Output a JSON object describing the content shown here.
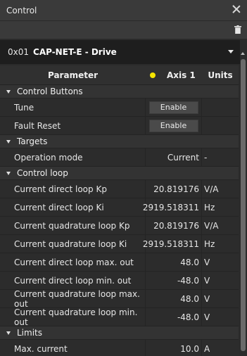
{
  "window": {
    "title": "Control",
    "close_icon": "close-icon",
    "trash_icon": "trash-icon"
  },
  "device": {
    "address": "0x01",
    "name": "CAP-NET-E - Drive"
  },
  "table": {
    "headers": {
      "parameter": "Parameter",
      "axis": "Axis 1",
      "units": "Units",
      "axis_dot_color": "#f5e400"
    },
    "groups": [
      {
        "label": "Control Buttons",
        "rows": [
          {
            "param": "Tune",
            "button": "Enable"
          },
          {
            "param": "Fault Reset",
            "button": "Enable"
          }
        ]
      },
      {
        "label": "Targets",
        "rows": [
          {
            "param": "Operation mode",
            "value": "Current",
            "unit": "-"
          }
        ]
      },
      {
        "label": "Control loop",
        "rows": [
          {
            "param": "Current direct loop Kp",
            "value": "20.819176",
            "unit": "V/A"
          },
          {
            "param": "Current direct loop Ki",
            "value": "2919.518311",
            "unit": "Hz"
          },
          {
            "param": "Current quadrature loop Kp",
            "value": "20.819176",
            "unit": "V/A"
          },
          {
            "param": "Current quadrature loop Ki",
            "value": "2919.518311",
            "unit": "Hz"
          },
          {
            "param": "Current direct loop max. out",
            "value": "48.0",
            "unit": "V"
          },
          {
            "param": "Current direct loop min. out",
            "value": "-48.0",
            "unit": "V"
          },
          {
            "param": "Current quadrature loop max. out",
            "value": "48.0",
            "unit": "V"
          },
          {
            "param": "Current quadrature loop min. out",
            "value": "-48.0",
            "unit": "V"
          }
        ]
      },
      {
        "label": "Limits",
        "rows": [
          {
            "param": "Max. current",
            "value": "10.0",
            "unit": "A"
          }
        ]
      }
    ]
  }
}
